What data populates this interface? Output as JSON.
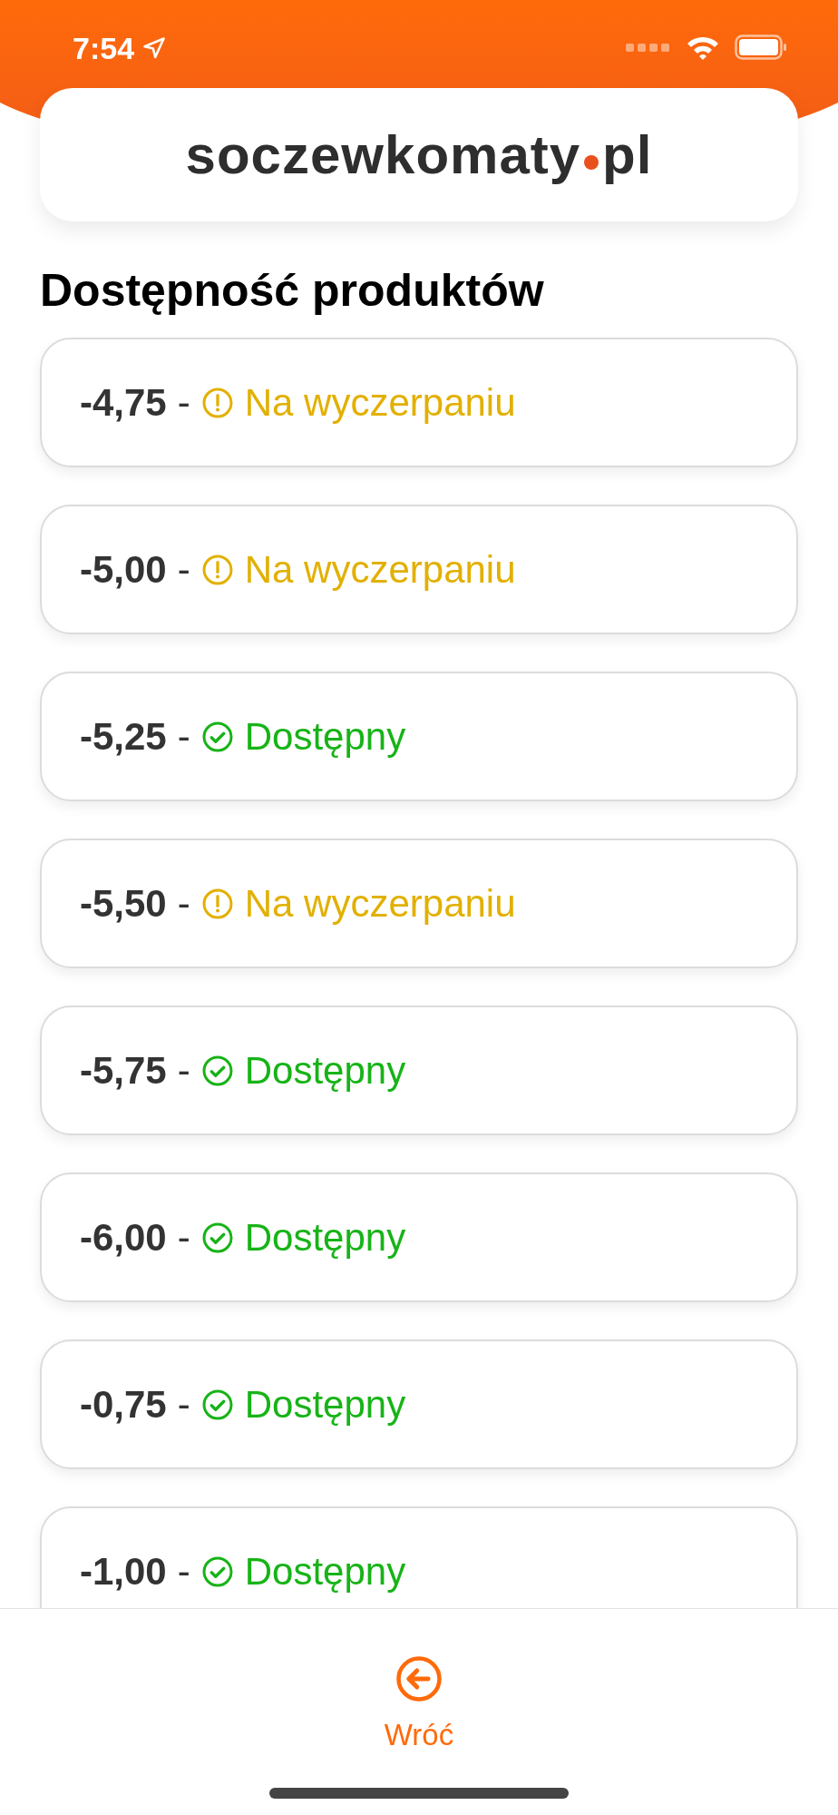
{
  "status_bar": {
    "time": "7:54"
  },
  "logo": {
    "name": "soczewkomaty",
    "domain": "pl"
  },
  "title": "Dostępność produktów",
  "items": [
    {
      "power": "-4,75",
      "separator": "-",
      "status": "Na wyczerpaniu",
      "kind": "low"
    },
    {
      "power": "-5,00",
      "separator": "-",
      "status": "Na wyczerpaniu",
      "kind": "low"
    },
    {
      "power": "-5,25",
      "separator": "-",
      "status": "Dostępny",
      "kind": "available"
    },
    {
      "power": "-5,50",
      "separator": "-",
      "status": "Na wyczerpaniu",
      "kind": "low"
    },
    {
      "power": "-5,75",
      "separator": "-",
      "status": "Dostępny",
      "kind": "available"
    },
    {
      "power": "-6,00",
      "separator": "-",
      "status": "Dostępny",
      "kind": "available"
    },
    {
      "power": "-0,75",
      "separator": "-",
      "status": "Dostępny",
      "kind": "available"
    },
    {
      "power": "-1,00",
      "separator": "-",
      "status": "Dostępny",
      "kind": "available"
    }
  ],
  "back_button": {
    "label": "Wróć"
  }
}
